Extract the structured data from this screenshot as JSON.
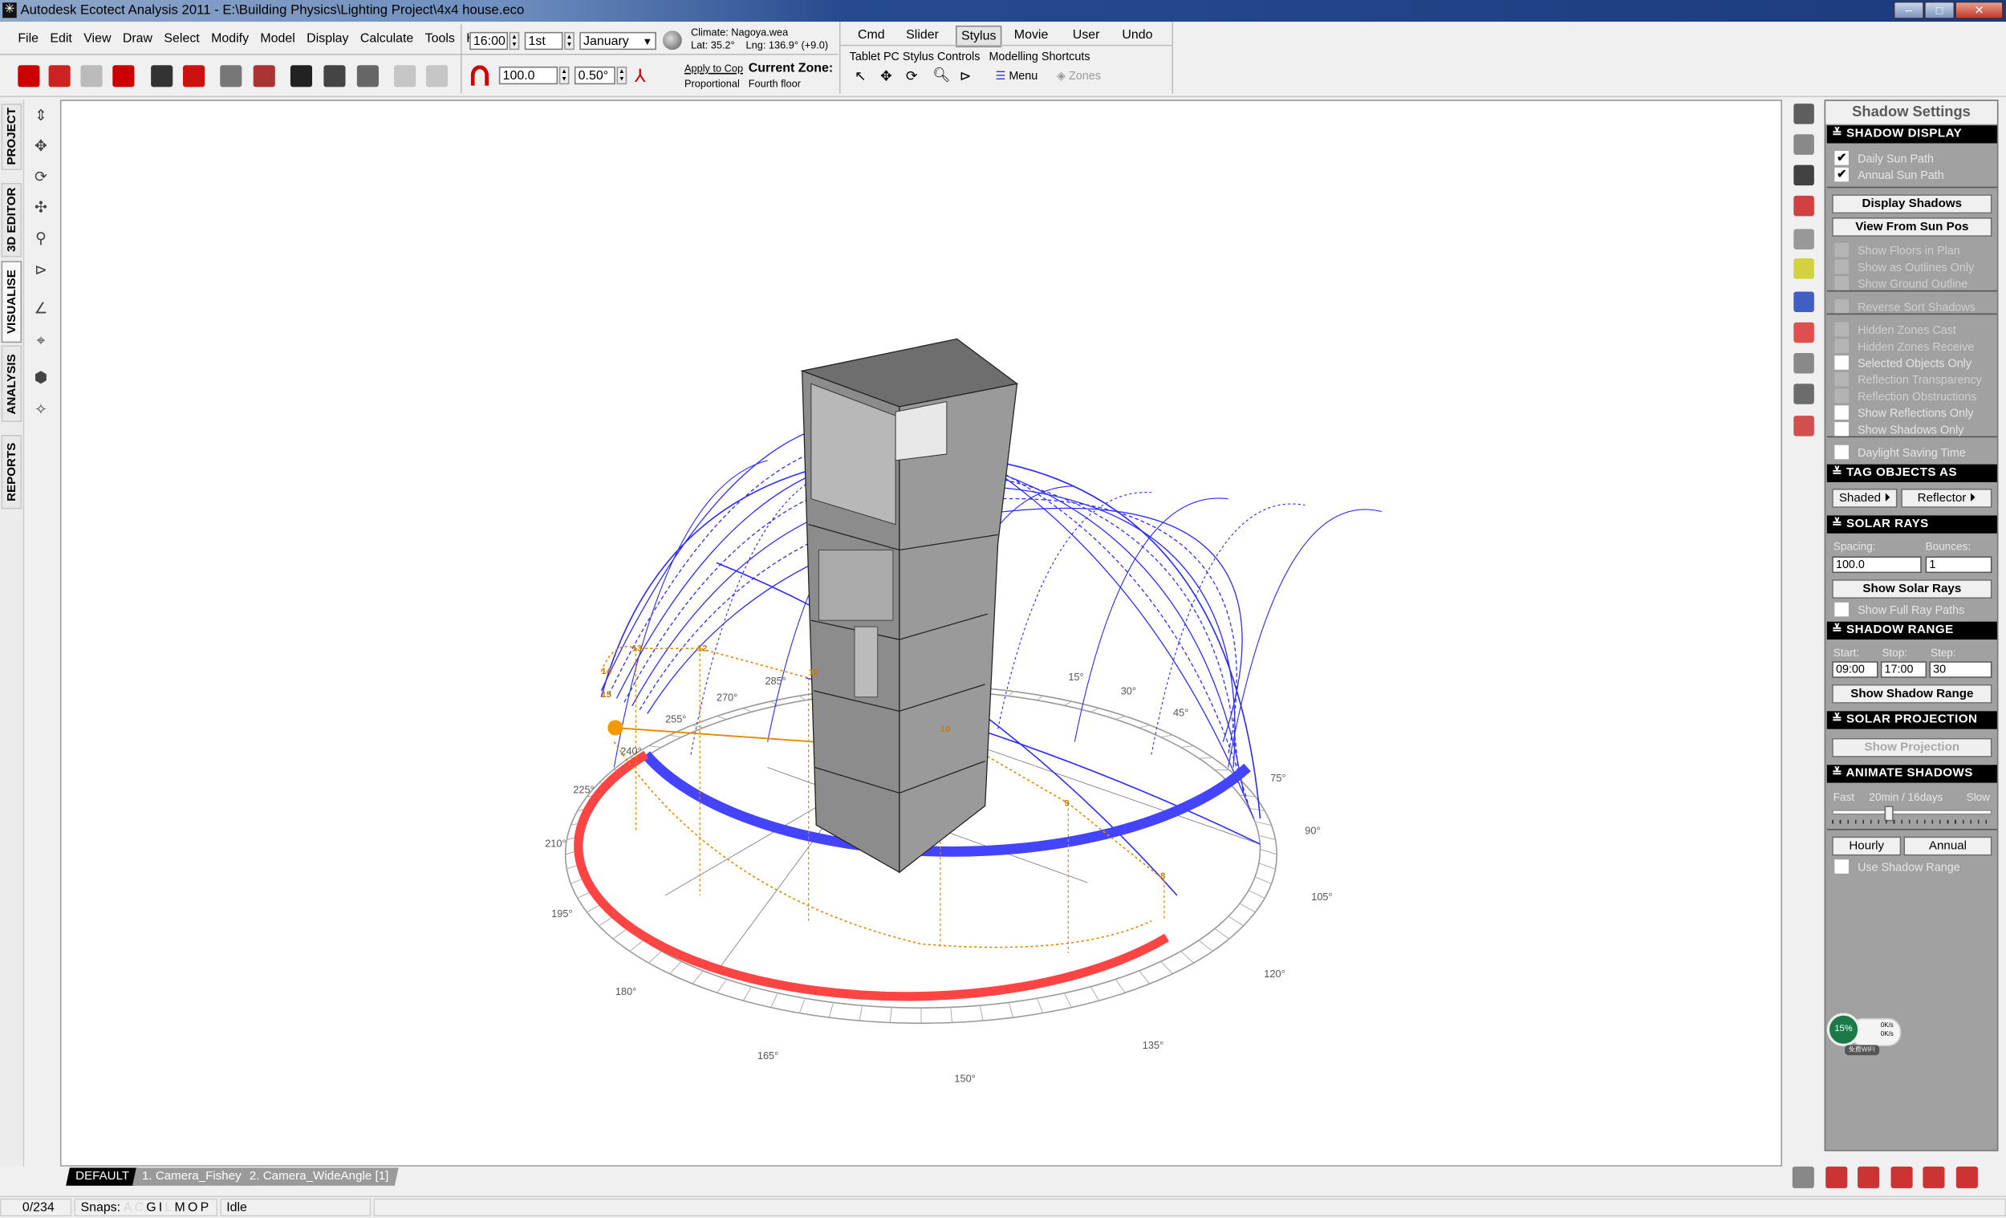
{
  "window": {
    "title": "Autodesk Ecotect Analysis 2011 - E:\\Building Physics\\Lighting Project\\4x4 house.eco",
    "minimize": "–",
    "maximize": "□",
    "close": "✕"
  },
  "menu": [
    "File",
    "Edit",
    "View",
    "Draw",
    "Select",
    "Modify",
    "Model",
    "Display",
    "Calculate",
    "Tools",
    "Help"
  ],
  "time_controls": {
    "time": "16:00",
    "day": "1st",
    "month": "January",
    "climate": "Climate: Nagoya.wea",
    "lat": "Lat: 35.2°",
    "lng": "Lng: 136.9° (+9.0)"
  },
  "toolbar_row2": {
    "icons": [
      "new-file-icon",
      "open-file-icon",
      "save-icon",
      "export-icon",
      "render-icon",
      "zone-icon",
      "layer-icon",
      "material-icon",
      "gear-icon",
      "gears-icon",
      "wizard-icon",
      "undo-icon",
      "redo-icon"
    ],
    "snap_value": "100.0",
    "angle_value": "0.50°",
    "apply_label": "Apply to Cop",
    "proportional_label": "Proportional",
    "current_zone_label": "Current Zone:",
    "current_zone": "Fourth floor"
  },
  "command_tabs": {
    "tabs": [
      "Cmd",
      "Slider",
      "Stylus",
      "Movie",
      "User",
      "Undo"
    ],
    "active": "Stylus",
    "stylus_label": "Tablet PC Stylus Controls",
    "shortcuts_label": "Modelling Shortcuts",
    "menu_label": "Menu",
    "zones_label": "Zones"
  },
  "side_tabs": [
    {
      "label": "PROJECT"
    },
    {
      "label": "3D EDITOR"
    },
    {
      "label": "VISUALISE",
      "active": true
    },
    {
      "label": "ANALYSIS"
    },
    {
      "label": "REPORTS"
    }
  ],
  "view_tools": [
    "pan-vertical-icon",
    "pan-icon",
    "orbit-icon",
    "dolly-icon",
    "zoom-icon",
    "perspective-icon",
    "angle-icon",
    "target-icon",
    "cube-view-icon",
    "fit-view-icon"
  ],
  "right_tools": [
    "select-arrow-icon",
    "layers-icon",
    "sun-settings-icon",
    "material-red-icon",
    "eye-icon",
    "sun-icon",
    "blue-book-icon",
    "scatter-icon",
    "bin-icon",
    "network-icon",
    "report-icon"
  ],
  "panel": {
    "title": "Shadow Settings",
    "shadow_display": {
      "header": "SHADOW DISPLAY",
      "checks": [
        {
          "label": "Daily Sun Path",
          "checked": true
        },
        {
          "label": "Annual Sun Path",
          "checked": true
        }
      ],
      "display_shadows": "Display Shadows",
      "view_from_sun": "View From Sun Pos",
      "options": [
        {
          "label": "Show Floors in Plan",
          "enabled": false
        },
        {
          "label": "Show as Outlines Only",
          "enabled": false
        },
        {
          "label": "Show Ground Outline",
          "enabled": false
        },
        {
          "label": "Reverse Sort Shadows",
          "enabled": false
        },
        {
          "label": "Hidden Zones Cast",
          "enabled": false
        },
        {
          "label": "Hidden Zones Receive",
          "enabled": false
        },
        {
          "label": "Selected Objects Only",
          "enabled": true
        },
        {
          "label": "Reflection Transparency",
          "enabled": false
        },
        {
          "label": "Reflection Obstructions",
          "enabled": false
        },
        {
          "label": "Show Reflections Only",
          "enabled": true
        },
        {
          "label": "Show Shadows Only",
          "enabled": true
        },
        {
          "label": "Daylight Saving Time",
          "enabled": true
        }
      ]
    },
    "tag_objects": {
      "header": "TAG OBJECTS AS",
      "shaded": "Shaded ⏵",
      "reflector": "Reflector ⏵"
    },
    "solar_rays": {
      "header": "SOLAR RAYS",
      "spacing_label": "Spacing:",
      "bounces_label": "Bounces:",
      "spacing": "100.0",
      "bounces": "1",
      "button": "Show Solar Rays",
      "full_paths": "Show Full Ray Paths"
    },
    "shadow_range": {
      "header": "SHADOW RANGE",
      "start_label": "Start:",
      "stop_label": "Stop:",
      "step_label": "Step:",
      "start": "09:00",
      "stop": "17:00",
      "step": "30",
      "button": "Show Shadow Range"
    },
    "solar_projection": {
      "header": "SOLAR PROJECTION",
      "button": "Show Projection"
    },
    "animate": {
      "header": "ANIMATE SHADOWS",
      "fast": "Fast",
      "speed": "20min / 16days",
      "slow": "Slow",
      "slider_fraction": 0.35,
      "hourly": "Hourly",
      "annual": "Annual",
      "use_range": "Use Shadow Range"
    }
  },
  "network_widget": {
    "percent": "15%",
    "up": "0K/s",
    "down": "0K/s",
    "wifi": "免费WIFI"
  },
  "view_tabs": [
    {
      "label": "DEFAULT",
      "active": true
    },
    {
      "label": "1. Camera_Fisheye"
    },
    {
      "label": "2. Camera_WideAngle [1]"
    }
  ],
  "status": {
    "count": "0/234",
    "snaps_label": "Snaps:",
    "snaps": [
      {
        "k": "A",
        "on": false
      },
      {
        "k": "C",
        "on": false
      },
      {
        "k": "G",
        "on": true
      },
      {
        "k": "I",
        "on": true
      },
      {
        "k": "L",
        "on": false
      },
      {
        "k": "M",
        "on": true
      },
      {
        "k": "O",
        "on": true
      },
      {
        "k": "P",
        "on": true
      }
    ],
    "state": "Idle"
  },
  "scene": {
    "azimuth_labels": [
      "15°",
      "30°",
      "45°",
      "75°",
      "90°",
      "105°",
      "120°",
      "135°",
      "150°",
      "165°",
      "180°",
      "195°",
      "210°",
      "225°",
      "240°",
      "255°",
      "270°",
      "285°"
    ],
    "hour_labels": [
      "8",
      "9",
      "10",
      "11",
      "12",
      "13",
      "14",
      "15"
    ],
    "colors": {
      "sun_path": "#2a2aff",
      "summer_band": "#4444ff",
      "winter_band": "#ff4444",
      "daily_path": "#e08a00",
      "building": "#8c8c8c"
    }
  },
  "bottom_tools": [
    "tool-a-icon",
    "tool-b-icon",
    "tool-c-icon",
    "tool-d-icon",
    "tool-e-icon",
    "camera-icon"
  ]
}
